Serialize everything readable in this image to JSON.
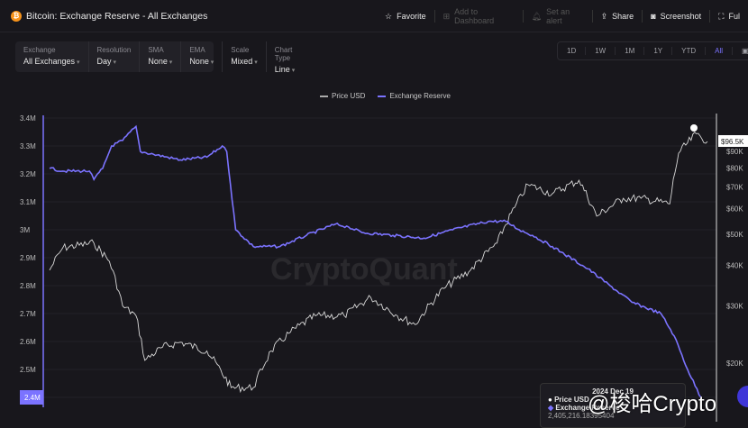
{
  "header": {
    "title": "Bitcoin: Exchange Reserve - All Exchanges",
    "logo": "₿",
    "actions": [
      {
        "label": "Favorite",
        "icon": "star-icon",
        "enabled": true
      },
      {
        "label": "Add to Dashboard",
        "icon": "dashboard-add-icon",
        "enabled": false
      },
      {
        "label": "Set an alert",
        "icon": "bell-icon",
        "enabled": false
      },
      {
        "label": "Share",
        "icon": "share-icon",
        "enabled": true
      },
      {
        "label": "Screenshot",
        "icon": "camera-icon",
        "enabled": true
      },
      {
        "label": "Ful",
        "icon": "fullscreen-icon",
        "enabled": true
      }
    ]
  },
  "filters": [
    {
      "label": "Exchange",
      "value": "All Exchanges"
    },
    {
      "label": "Resolution",
      "value": "Day"
    },
    {
      "label": "SMA",
      "value": "None"
    },
    {
      "label": "EMA",
      "value": "None"
    },
    {
      "label": "Scale",
      "value": "Mixed"
    },
    {
      "label": "Chart Type",
      "value": "Line"
    }
  ],
  "ranges": [
    "1D",
    "1W",
    "1M",
    "1Y",
    "YTD",
    "All"
  ],
  "active_range": "All",
  "watermark": "CryptoQuant",
  "overlay_text": "@梭哈Crypto",
  "tooltip": {
    "date": "2024 Dec 19",
    "price_label": "Price USD",
    "price_value": "",
    "reserve_label": "Exchange Reserve",
    "reserve_value": "2,405,216.18395404"
  },
  "colors": {
    "reserve": "#7b73ff",
    "price": "#d0d0d0"
  },
  "chart_data": {
    "type": "line",
    "legend": [
      "Price USD",
      "Exchange Reserve"
    ],
    "left_axis": {
      "label": "Exchange Reserve",
      "ticks": [
        "3.4M",
        "3.3M",
        "3.2M",
        "3.1M",
        "3M",
        "2.9M",
        "2.8M",
        "2.7M",
        "2.6M",
        "2.5M",
        "2.4M"
      ],
      "range": [
        2.4,
        3.4
      ]
    },
    "right_axis": {
      "label": "Price USD",
      "scale": "log",
      "ticks": [
        "$90K",
        "$80K",
        "$70K",
        "$60K",
        "$50K",
        "$40K",
        "$30K",
        "$20K"
      ],
      "current": "$96.5K"
    },
    "x_range": [
      2022.0,
      2024.97
    ],
    "series": [
      {
        "name": "Exchange Reserve",
        "unit": "M",
        "points": [
          [
            2022.0,
            3.22
          ],
          [
            2022.06,
            3.21
          ],
          [
            2022.18,
            3.21
          ],
          [
            2022.2,
            3.18
          ],
          [
            2022.24,
            3.22
          ],
          [
            2022.28,
            3.3
          ],
          [
            2022.33,
            3.32
          ],
          [
            2022.39,
            3.37
          ],
          [
            2022.41,
            3.28
          ],
          [
            2022.47,
            3.27
          ],
          [
            2022.59,
            3.25
          ],
          [
            2022.71,
            3.26
          ],
          [
            2022.78,
            3.3
          ],
          [
            2022.8,
            3.28
          ],
          [
            2022.84,
            3.0
          ],
          [
            2022.92,
            2.94
          ],
          [
            2023.04,
            2.94
          ],
          [
            2023.16,
            2.98
          ],
          [
            2023.29,
            3.02
          ],
          [
            2023.35,
            3.01
          ],
          [
            2023.41,
            2.99
          ],
          [
            2023.55,
            2.98
          ],
          [
            2023.69,
            2.97
          ],
          [
            2023.82,
            3.0
          ],
          [
            2023.98,
            3.03
          ],
          [
            2024.06,
            3.03
          ],
          [
            2024.12,
            3.0
          ],
          [
            2024.18,
            2.98
          ],
          [
            2024.27,
            2.94
          ],
          [
            2024.31,
            2.92
          ],
          [
            2024.43,
            2.86
          ],
          [
            2024.53,
            2.8
          ],
          [
            2024.63,
            2.74
          ],
          [
            2024.76,
            2.7
          ],
          [
            2024.82,
            2.62
          ],
          [
            2024.88,
            2.5
          ],
          [
            2024.94,
            2.4
          ]
        ]
      },
      {
        "name": "Price USD",
        "unit": "K",
        "points": [
          [
            2022.0,
            38.7
          ],
          [
            2022.06,
            45.4
          ],
          [
            2022.2,
            46.9
          ],
          [
            2022.27,
            41.2
          ],
          [
            2022.33,
            30.0
          ],
          [
            2022.39,
            28.0
          ],
          [
            2022.43,
            20.4
          ],
          [
            2022.51,
            22.4
          ],
          [
            2022.59,
            23.2
          ],
          [
            2022.71,
            21.8
          ],
          [
            2022.82,
            16.8
          ],
          [
            2022.92,
            16.8
          ],
          [
            2023.0,
            21.8
          ],
          [
            2023.08,
            24.7
          ],
          [
            2023.2,
            28.0
          ],
          [
            2023.33,
            28.0
          ],
          [
            2023.45,
            31.9
          ],
          [
            2023.57,
            28.0
          ],
          [
            2023.65,
            26.3
          ],
          [
            2023.78,
            34.0
          ],
          [
            2023.9,
            38.7
          ],
          [
            2024.02,
            46.9
          ],
          [
            2024.1,
            60.5
          ],
          [
            2024.16,
            71.0
          ],
          [
            2024.27,
            66.6
          ],
          [
            2024.39,
            73.3
          ],
          [
            2024.47,
            56.8
          ],
          [
            2024.59,
            64.5
          ],
          [
            2024.67,
            64.5
          ],
          [
            2024.8,
            62.0
          ],
          [
            2024.84,
            88.8
          ],
          [
            2024.92,
            102
          ],
          [
            2024.97,
            96.5
          ]
        ]
      }
    ]
  }
}
